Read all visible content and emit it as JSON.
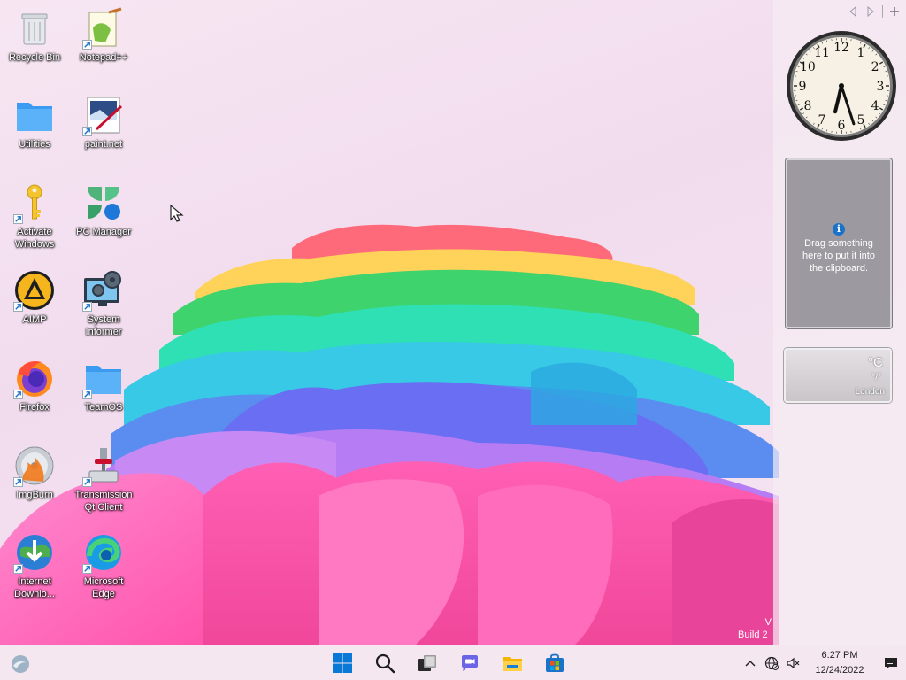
{
  "desktop": {
    "icons": [
      {
        "label": "Recycle Bin",
        "icon": "recycle-bin-icon",
        "shortcut": false
      },
      {
        "label": "Notepad++",
        "icon": "notepad-plus-plus-icon",
        "shortcut": true
      },
      {
        "label": "Utilities",
        "icon": "folder-icon",
        "shortcut": false
      },
      {
        "label": "paint.net",
        "icon": "paint-net-icon",
        "shortcut": true
      },
      {
        "label": "Activate\nWindows",
        "icon": "key-icon",
        "shortcut": true
      },
      {
        "label": "PC Manager",
        "icon": "pc-manager-icon",
        "shortcut": false
      },
      {
        "label": "AIMP",
        "icon": "aimp-icon",
        "shortcut": true
      },
      {
        "label": "System\nInformer",
        "icon": "system-informer-icon",
        "shortcut": true
      },
      {
        "label": "Firefox",
        "icon": "firefox-icon",
        "shortcut": true
      },
      {
        "label": "TeamOS",
        "icon": "folder-icon",
        "shortcut": true
      },
      {
        "label": "ImgBurn",
        "icon": "imgburn-icon",
        "shortcut": true
      },
      {
        "label": "Transmission\nQt Client",
        "icon": "transmission-icon",
        "shortcut": true
      },
      {
        "label": "Internet\nDownlo...",
        "icon": "internet-download-manager-icon",
        "shortcut": true
      },
      {
        "label": "Microsoft\nEdge",
        "icon": "edge-icon",
        "shortcut": true
      }
    ]
  },
  "sidebar": {
    "clock": {
      "hour": 6,
      "minute": 27,
      "numerals": [
        "12",
        "1",
        "2",
        "3",
        "4",
        "5",
        "6",
        "7",
        "8",
        "9",
        "10",
        "11"
      ]
    },
    "clipboard": {
      "info_icon": "i",
      "text": "Drag something here to put it into the clipboard."
    },
    "weather": {
      "unit": "°C",
      "range": "°/°",
      "city": "London"
    }
  },
  "watermark": {
    "line1": "V",
    "line2": "Build 2"
  },
  "taskbar": {
    "buttons": [
      {
        "name": "start",
        "icon": "windows-logo-icon"
      },
      {
        "name": "search",
        "icon": "search-icon"
      },
      {
        "name": "task-view",
        "icon": "task-view-icon"
      },
      {
        "name": "teams-chat",
        "icon": "chat-icon"
      },
      {
        "name": "file-explorer",
        "icon": "file-explorer-icon"
      },
      {
        "name": "microsoft-store",
        "icon": "store-icon"
      }
    ],
    "tray": {
      "time": "6:27 PM",
      "date": "12/24/2022"
    }
  },
  "colors": {
    "accent_blue": "#1a73c9",
    "taskbar_bg": "#f5e7ef",
    "clipboard_bg": "#9c9aa0"
  }
}
